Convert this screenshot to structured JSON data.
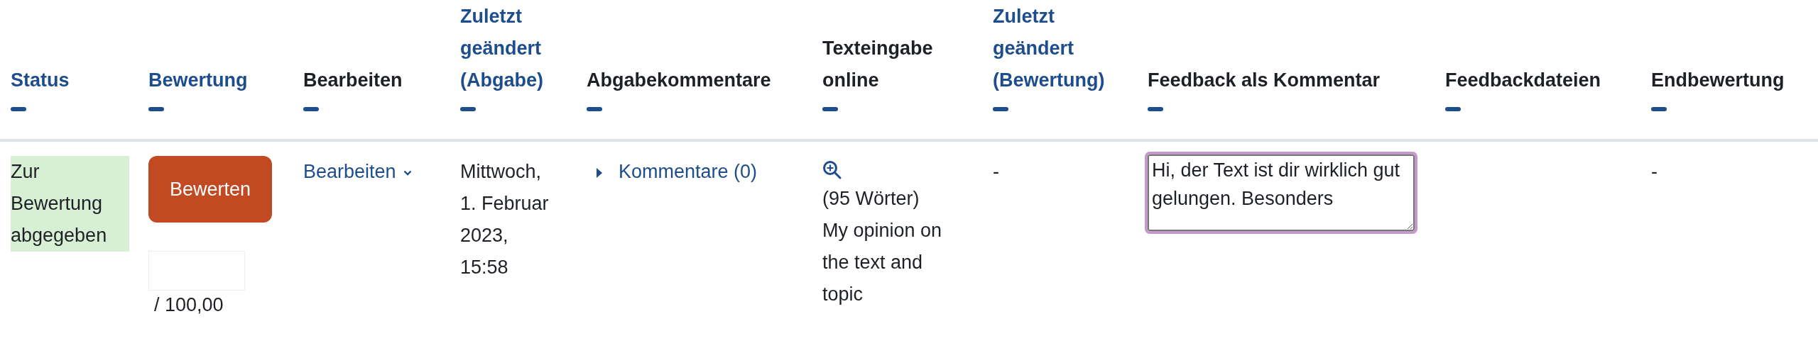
{
  "table": {
    "columns": [
      {
        "label": "Status",
        "sortable": true
      },
      {
        "label": "Bewertung",
        "sortable": true
      },
      {
        "label": "Bearbeiten",
        "sortable": false
      },
      {
        "label": "Zuletzt geändert (Abgabe)",
        "sortable": true
      },
      {
        "label": "Abgabekommentare",
        "sortable": false
      },
      {
        "label": "Texteingabe online",
        "sortable": false
      },
      {
        "label": "Zuletzt geändert (Bewertung)",
        "sortable": true
      },
      {
        "label": "Feedback als Kommentar",
        "sortable": false
      },
      {
        "label": "Feedbackdateien",
        "sortable": false
      },
      {
        "label": "Endbewertung",
        "sortable": false
      }
    ],
    "rows": [
      {
        "status": "Zur Bewertung abgegeben",
        "grade_button": "Bewerten",
        "grade_max": "/ 100,00",
        "edit_menu": "Bearbeiten",
        "modified_submission": "Mittwoch, 1. Februar 2023, 15:58",
        "comments_link": "Kommentare (0)",
        "word_count": "(95 Wörter)",
        "online_text": "My opinion on the text and topic",
        "modified_grading": "-",
        "feedback_comment": "Hi, der Text ist dir wirklich gut gelungen. Besonders",
        "final_grade": "-"
      }
    ]
  }
}
